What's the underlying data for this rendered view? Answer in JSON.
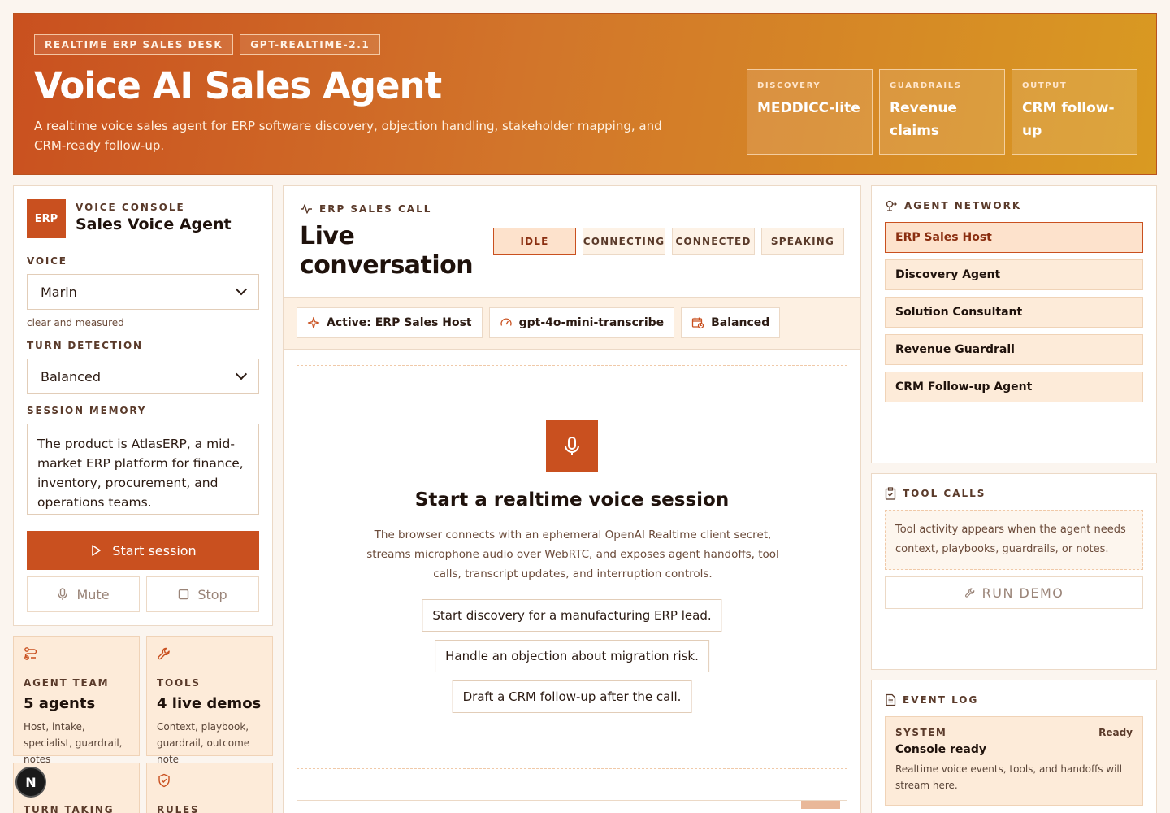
{
  "hero": {
    "tags": [
      "REALTIME ERP SALES DESK",
      "GPT-REALTIME-2.1"
    ],
    "title": "Voice AI Sales Agent",
    "subtitle": "A realtime voice sales agent for ERP software discovery, objection handling, stakeholder mapping, and CRM-ready follow-up.",
    "stats": [
      {
        "label": "DISCOVERY",
        "value": "MEDDICC-lite"
      },
      {
        "label": "GUARDRAILS",
        "value": "Revenue claims"
      },
      {
        "label": "OUTPUT",
        "value": "CRM follow-up"
      }
    ]
  },
  "console": {
    "badge": "ERP",
    "eyebrow": "VOICE CONSOLE",
    "title": "Sales Voice Agent",
    "voice_label": "VOICE",
    "voice_value": "Marin",
    "voice_hint": "clear and measured",
    "turn_label": "TURN DETECTION",
    "turn_value": "Balanced",
    "memory_label": "SESSION MEMORY",
    "memory_value": "The product is AtlasERP, a mid-market ERP platform for finance, inventory, procurement, and operations teams.",
    "start_label": "Start session",
    "mute_label": "Mute",
    "stop_label": "Stop"
  },
  "cards": [
    {
      "icon": "workflow-icon",
      "label": "AGENT TEAM",
      "value": "5 agents",
      "desc": "Host, intake, specialist, guardrail, notes"
    },
    {
      "icon": "wrench-icon",
      "label": "TOOLS",
      "value": "4 live demos",
      "desc": "Context, playbook, guardrail, outcome note"
    },
    {
      "icon": "",
      "label": "TURN TAKING",
      "value": "",
      "desc": ""
    },
    {
      "icon": "shield-check-icon",
      "label": "RULES",
      "value": "",
      "desc": ""
    }
  ],
  "next_badge": "N",
  "center": {
    "eyebrow": "ERP SALES CALL",
    "title": "Live conversation",
    "states": [
      "IDLE",
      "CONNECTING",
      "CONNECTED",
      "SPEAKING"
    ],
    "active_state": "IDLE",
    "chips": [
      {
        "icon": "sparkles-icon",
        "label": "Active: ERP Sales Host"
      },
      {
        "icon": "gauge-icon",
        "label": "gpt-4o-mini-transcribe"
      },
      {
        "icon": "calendar-clock-icon",
        "label": "Balanced"
      }
    ],
    "stage_title": "Start a realtime voice session",
    "stage_desc": "The browser connects with an ephemeral OpenAI Realtime client secret, streams microphone audio over WebRTC, and exposes agent handoffs, tool calls, transcript updates, and interruption controls.",
    "prompts": [
      "Start discovery for a manufacturing ERP lead.",
      "Handle an objection about migration risk.",
      "Draft a CRM follow-up after the call."
    ]
  },
  "network": {
    "eyebrow": "AGENT NETWORK",
    "agents": [
      "ERP Sales Host",
      "Discovery Agent",
      "Solution Consultant",
      "Revenue Guardrail",
      "CRM Follow-up Agent"
    ],
    "active_agent": "ERP Sales Host"
  },
  "tools": {
    "eyebrow": "TOOL CALLS",
    "empty": "Tool activity appears when the agent needs context, playbooks, guardrails, or notes.",
    "run_demo": "RUN DEMO"
  },
  "events": {
    "eyebrow": "EVENT LOG",
    "items": [
      {
        "category": "SYSTEM",
        "status": "Ready",
        "title": "Console ready",
        "desc": "Realtime voice events, tools, and handoffs will stream here."
      }
    ]
  },
  "colors": {
    "accent": "#c9501f",
    "accent_soft": "#fdebd9",
    "gradient_end": "#d99a22"
  }
}
